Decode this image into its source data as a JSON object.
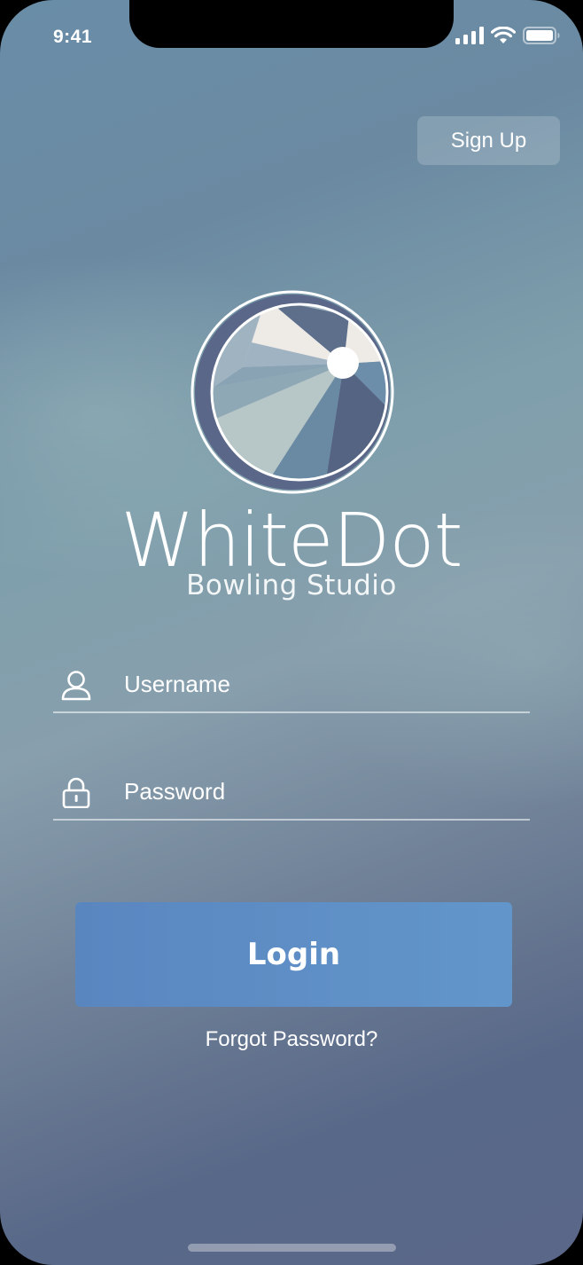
{
  "status_bar": {
    "time": "9:41",
    "icons": [
      "cellular-signal-icon",
      "wifi-icon",
      "battery-icon"
    ]
  },
  "header": {
    "signup_label": "Sign Up"
  },
  "brand": {
    "name": "WhiteDot",
    "subtitle": "Bowling Studio",
    "logo_icon": "bowling-ball-logo"
  },
  "form": {
    "username": {
      "placeholder": "Username",
      "value": "",
      "icon": "user-icon"
    },
    "password": {
      "placeholder": "Password",
      "value": "",
      "icon": "lock-icon"
    },
    "login_label": "Login",
    "forgot_label": "Forgot Password?"
  },
  "colors": {
    "login_button": "#5f8fc6",
    "signup_button": "rgba(255,255,255,0.18)",
    "logo_ring": "#5a6788"
  }
}
